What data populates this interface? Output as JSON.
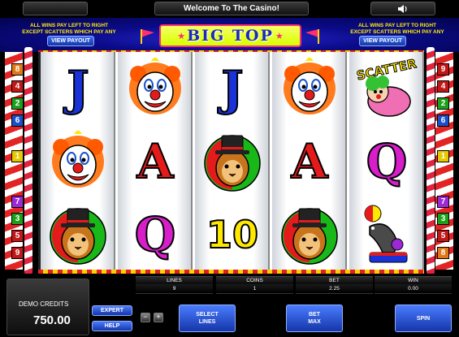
{
  "topbar": {
    "title": "Welcome To The Casino!"
  },
  "header": {
    "rule_text_line1": "ALL WINS PAY LEFT TO RIGHT",
    "rule_text_line2": "EXCEPT SCATTERS WHICH PAY ANY",
    "view_payout_label": "VIEW PAYOUT",
    "logo": "BIG TOP"
  },
  "paylines": {
    "left": [
      "8",
      "4",
      "2",
      "6",
      "1",
      "7",
      "3",
      "5",
      "9"
    ],
    "right": [
      "9",
      "4",
      "2",
      "6",
      "1",
      "7",
      "3",
      "5",
      "8"
    ]
  },
  "line_badge_colors": {
    "1": "#e6c800",
    "2": "#1aa01a",
    "3": "#1aa01a",
    "4": "#c01818",
    "5": "#c01818",
    "6": "#1a50c8",
    "7": "#9b2ad6",
    "8": "#e07818",
    "9": "#c01818"
  },
  "reels": [
    [
      "J",
      "clown",
      "lion"
    ],
    [
      "clown",
      "A",
      "Q"
    ],
    [
      "J",
      "lion",
      "10"
    ],
    [
      "clown",
      "A",
      "lion"
    ],
    [
      "scatter",
      "Q",
      "seal"
    ]
  ],
  "scatter_label": "SCATTER",
  "symbol_colors": {
    "J": "#1a33d9",
    "A": "#e41b1b",
    "Q": "#d61fc9",
    "10": "#ffe800"
  },
  "meters": {
    "lines": {
      "label": "LINES",
      "value": "9"
    },
    "coins": {
      "label": "COINS",
      "value": "1"
    },
    "bet": {
      "label": "BET",
      "value": "2.25"
    },
    "win": {
      "label": "WIN",
      "value": "0.00"
    }
  },
  "credits": {
    "label": "DEMO CREDITS",
    "value": "750.00"
  },
  "buttons": {
    "expert": "EXPERT",
    "help": "HELP",
    "minus": "−",
    "plus": "+",
    "select_lines_1": "SELECT",
    "select_lines_2": "LINES",
    "bet_max_1": "BET",
    "bet_max_2": "MAX",
    "spin": "SPIN"
  }
}
